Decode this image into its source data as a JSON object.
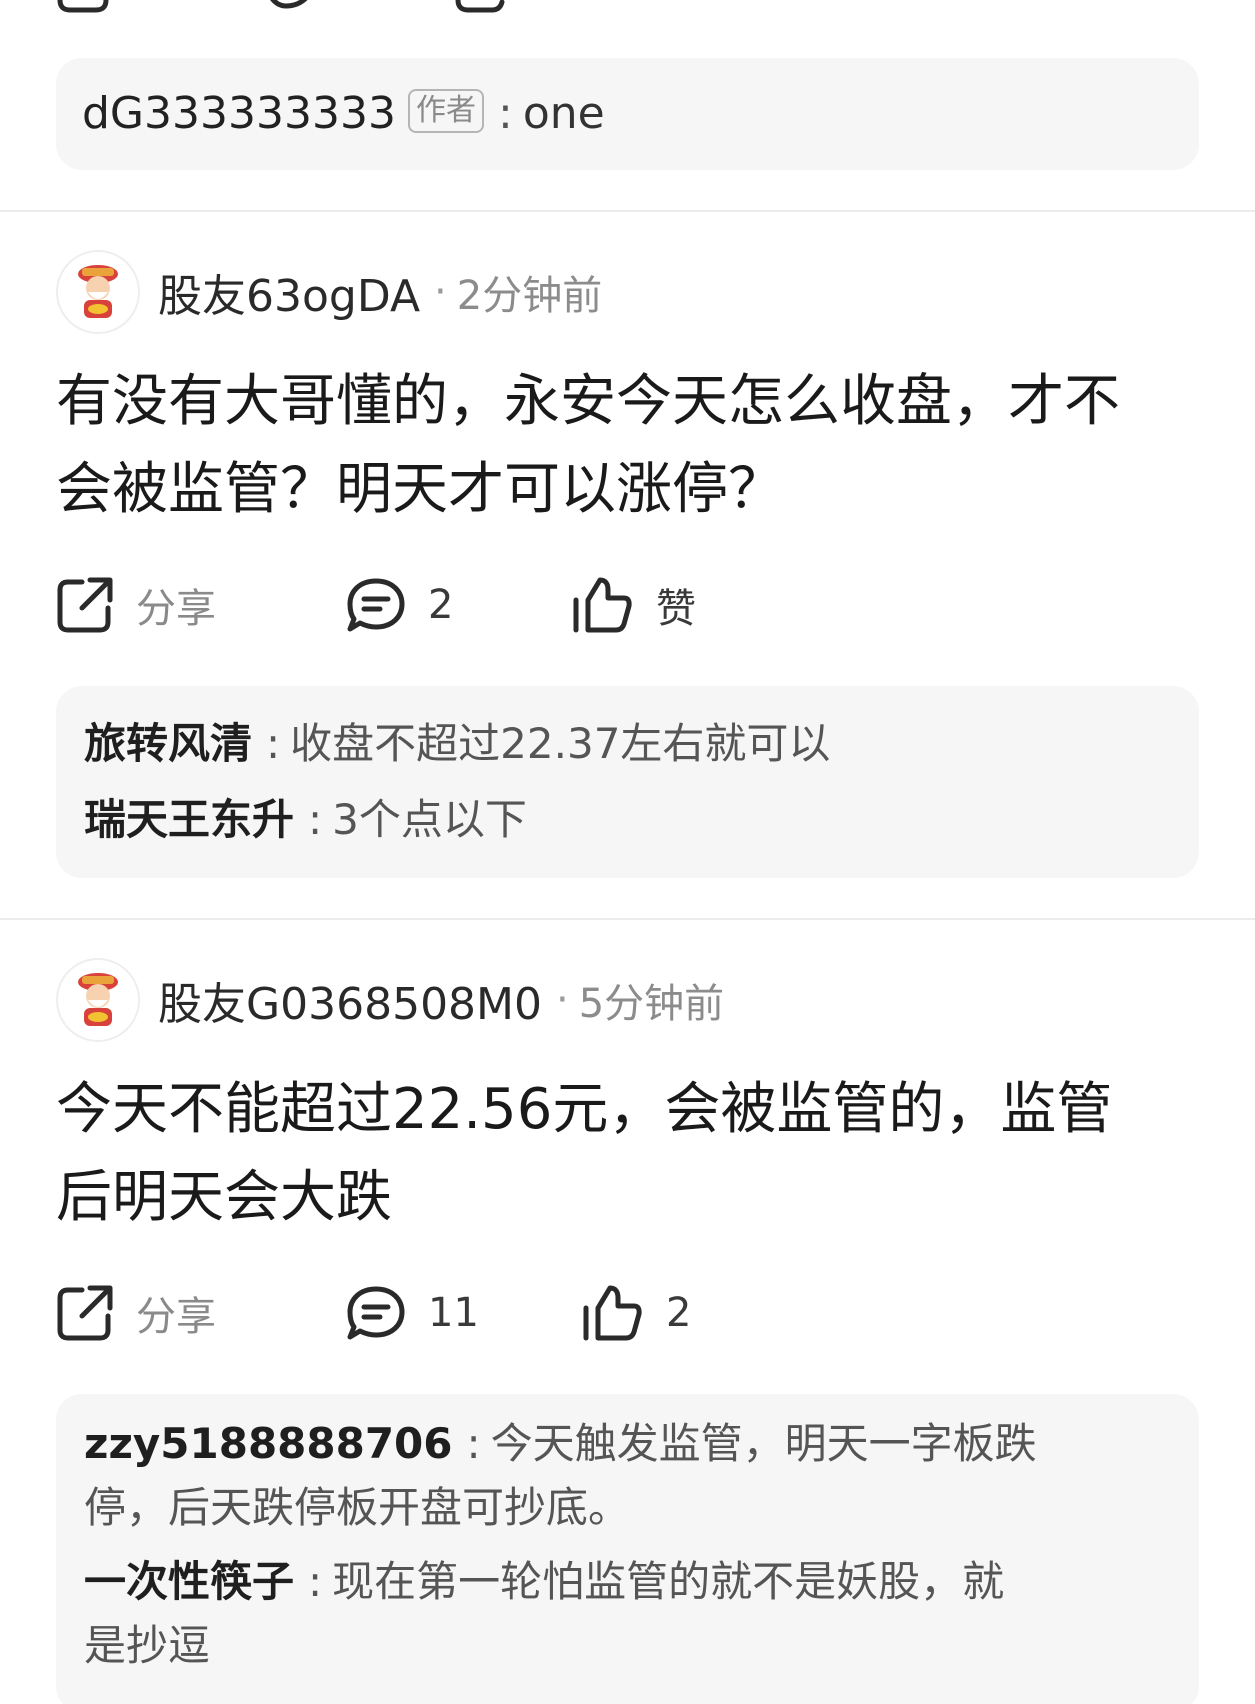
{
  "top_reply": {
    "name": "dG333333333",
    "badge": "作者",
    "text": "one"
  },
  "posts": [
    {
      "user": "股友63ogDA",
      "time": "2分钟前",
      "text_line1": "有没有大哥懂的，永安今天怎么收盘，才不",
      "text_line2": "会被监管？明天才可以涨停？",
      "share_label": "分享",
      "comment_count": "2",
      "like_label": "赞",
      "replies": [
        {
          "name": "旅转风清",
          "text": "收盘不超过22.37左右就可以"
        },
        {
          "name": "瑞天王东升",
          "text": "3个点以下"
        }
      ]
    },
    {
      "user": "股友G0368508M0",
      "time": "5分钟前",
      "text_line1": "今天不能超过22.56元，会被监管的，监管",
      "text_line2": "后明天会大跌",
      "share_label": "分享",
      "comment_count": "11",
      "like_label": "2",
      "replies": [
        {
          "name": "zzy5188888706",
          "text": "今天触发监管，明天一字板跌",
          "text2": "停，后天跌停板开盘可抄底。"
        },
        {
          "name": "一次性筷子",
          "text": "现在第一轮怕监管的就不是妖股，就",
          "text2": "是抄逗"
        }
      ]
    }
  ],
  "separator_dot": "·",
  "colon": ":"
}
